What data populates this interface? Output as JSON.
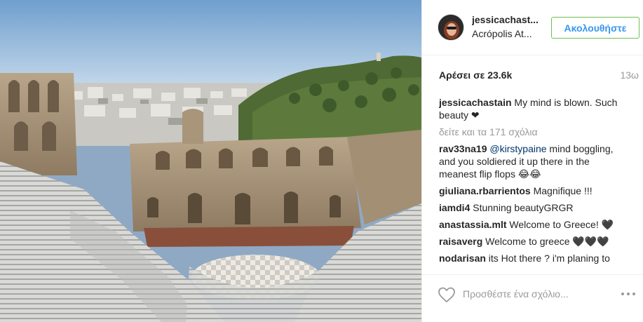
{
  "post": {
    "photo_alt": "Odeon of Herodes Atticus, Acropolis, Athens",
    "author": {
      "username": "jessicachast...",
      "location": "Acrópolis At..."
    },
    "follow_label": "Ακολουθήστε",
    "likes": "Αρέσει σε 23.6k",
    "time_ago": "13ω",
    "view_all_comments": "δείτε και τα 171 σχόλια",
    "caption": {
      "user": "jessicachastain",
      "text": " My mind is blown. Such beauty ❤"
    },
    "comments": [
      {
        "user": "rav33na19",
        "mention": "@kirstypaine",
        "text": " mind boggling, and you soldiered it up there in the meanest flip flops 😂😂"
      },
      {
        "user": "giuliana.rbarrientos",
        "mention": "",
        "text": " Magnifique !!!"
      },
      {
        "user": "iamdi4",
        "mention": "",
        "text": " Stunning beautyGRGR"
      },
      {
        "user": "anastassia.mlt",
        "mention": "",
        "text": " Welcome to Greece! 🖤"
      },
      {
        "user": "raisaverg",
        "mention": "",
        "text": " Welcome to greece 🖤🖤🖤"
      },
      {
        "user": "nodarisan",
        "mention": "",
        "text": " its Hot there ? i'm planing to"
      }
    ],
    "comment_placeholder": "Προσθέστε ένα σχόλιο...",
    "icons": {
      "like": "heart-outline-icon",
      "more": "more-options-icon"
    },
    "colors": {
      "follow_text": "#3897f0",
      "follow_border": "#70c050",
      "mention": "#003569",
      "muted": "#999999"
    }
  }
}
